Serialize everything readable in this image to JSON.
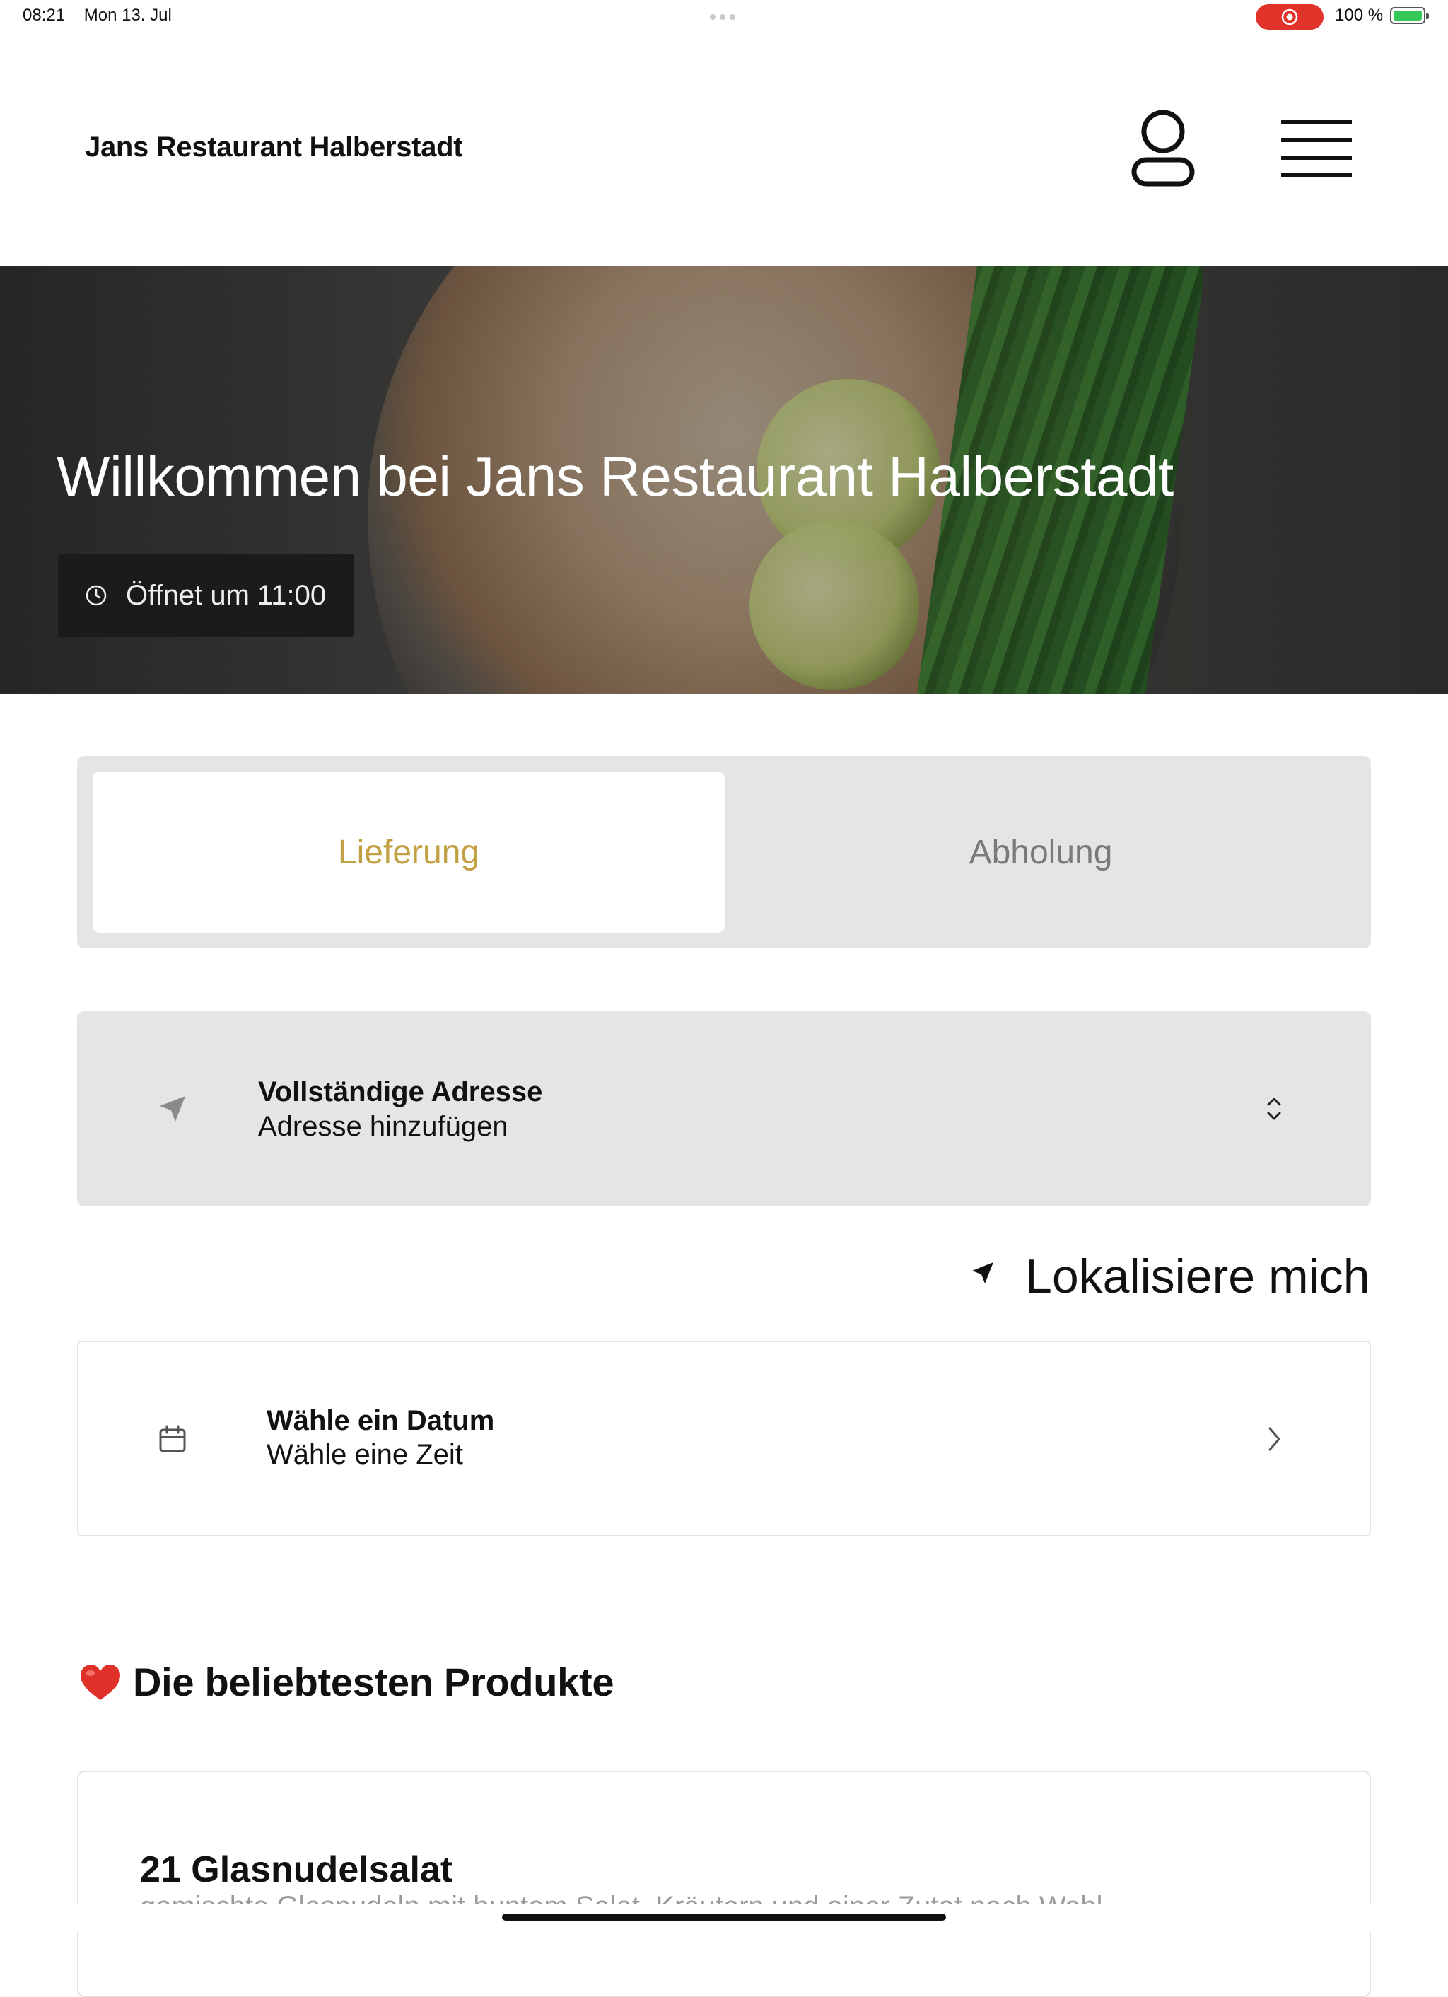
{
  "status_bar": {
    "time": "08:21",
    "date": "Mon 13. Jul",
    "battery": "100 %",
    "colors": {
      "recording": "#e2332a",
      "battery": "#34c759"
    }
  },
  "header": {
    "brand": "Jans Restaurant Halberstadt",
    "icons": [
      "user-icon",
      "menu-icon"
    ]
  },
  "hero": {
    "title": "Willkommen bei Jans Restaurant Halberstadt",
    "opening": "Öffnet um 11:00"
  },
  "order_type": {
    "active": "Lieferung",
    "inactive": "Abholung",
    "accent_color": "#c2a044"
  },
  "address": {
    "title": "Vollständige Adresse",
    "placeholder": "Adresse hinzufügen"
  },
  "locate": {
    "label": "Lokalisiere mich"
  },
  "date_picker": {
    "title": "Wähle ein Datum",
    "subtitle": "Wähle eine Zeit"
  },
  "popular": {
    "heading": "Die beliebtesten Produkte",
    "products": [
      {
        "name": "21 Glasnudelsalat",
        "description": "gemischte Glasnudeln mit buntem Salat, Kräutern und einer Zutat nach Wahl"
      }
    ]
  }
}
